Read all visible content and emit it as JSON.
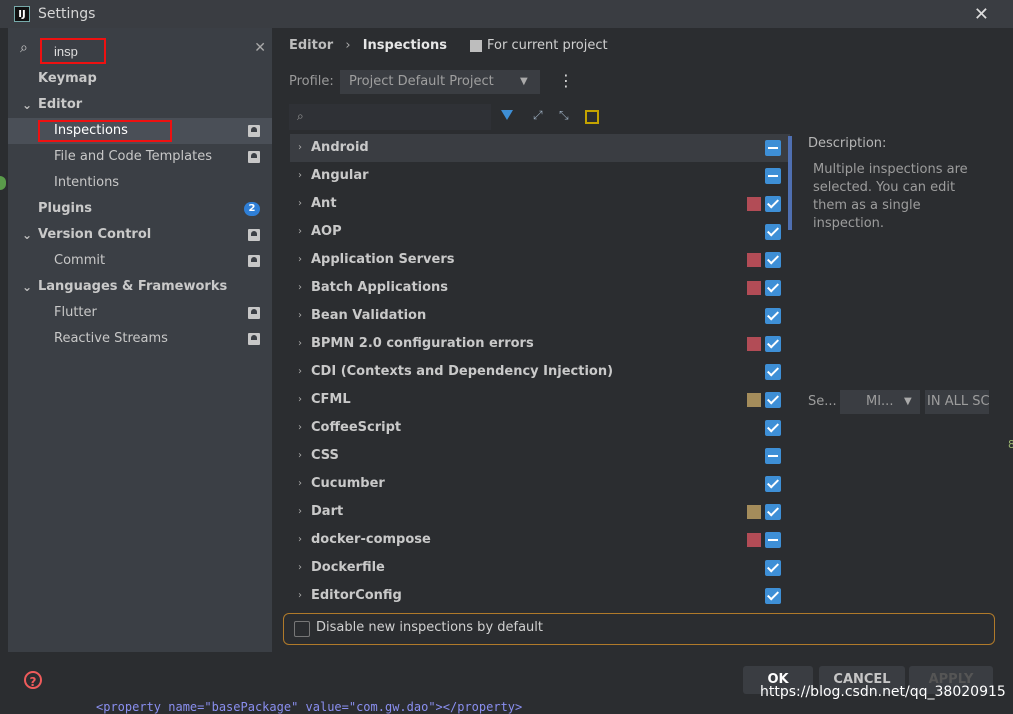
{
  "window": {
    "title": "Settings"
  },
  "search": {
    "value": "insp"
  },
  "sidebar": {
    "items": [
      {
        "label": "Keymap"
      },
      {
        "label": "Editor"
      },
      {
        "label": "Inspections"
      },
      {
        "label": "File and Code Templates"
      },
      {
        "label": "Intentions"
      },
      {
        "label": "Plugins",
        "badge": "2"
      },
      {
        "label": "Version Control"
      },
      {
        "label": "Commit"
      },
      {
        "label": "Languages & Frameworks"
      },
      {
        "label": "Flutter"
      },
      {
        "label": "Reactive Streams"
      }
    ]
  },
  "breadcrumb": {
    "parent": "Editor",
    "current": "Inspections",
    "scope": "For current project"
  },
  "profile": {
    "label": "Profile:",
    "value": "Project Default  Project"
  },
  "inspections": [
    {
      "label": "Android",
      "state": "mixed",
      "severity_color": ""
    },
    {
      "label": "Angular",
      "state": "mixed",
      "severity_color": ""
    },
    {
      "label": "Ant",
      "state": "checked",
      "severity_color": "#b24c56"
    },
    {
      "label": "AOP",
      "state": "checked",
      "severity_color": ""
    },
    {
      "label": "Application Servers",
      "state": "checked",
      "severity_color": "#b24c56"
    },
    {
      "label": "Batch Applications",
      "state": "checked",
      "severity_color": "#b24c56"
    },
    {
      "label": "Bean Validation",
      "state": "checked",
      "severity_color": ""
    },
    {
      "label": "BPMN 2.0 configuration errors",
      "state": "checked",
      "severity_color": "#b24c56"
    },
    {
      "label": "CDI (Contexts and Dependency Injection)",
      "state": "checked",
      "severity_color": ""
    },
    {
      "label": "CFML",
      "state": "checked",
      "severity_color": "#a48c5b"
    },
    {
      "label": "CoffeeScript",
      "state": "checked",
      "severity_color": ""
    },
    {
      "label": "CSS",
      "state": "mixed",
      "severity_color": ""
    },
    {
      "label": "Cucumber",
      "state": "checked",
      "severity_color": ""
    },
    {
      "label": "Dart",
      "state": "checked",
      "severity_color": "#a48c5b"
    },
    {
      "label": "docker-compose",
      "state": "mixed",
      "severity_color": "#b24c56"
    },
    {
      "label": "Dockerfile",
      "state": "checked",
      "severity_color": ""
    },
    {
      "label": "EditorConfig",
      "state": "checked",
      "severity_color": ""
    }
  ],
  "description": {
    "label": "Description:",
    "text": "Multiple inspections are selected. You can edit them as a single inspection."
  },
  "severity": {
    "label": "Se...",
    "value": "MI...",
    "scope": "IN ALL SC"
  },
  "options": {
    "disable_new": "Disable new inspections by default"
  },
  "buttons": {
    "ok": "OK",
    "cancel": "CANCEL",
    "apply": "APPLY"
  },
  "watermark": "https://blog.csdn.net/qq_38020915",
  "background_code": "<property name=\"basePackage\" value=\"com.gw.dao\"></property>"
}
